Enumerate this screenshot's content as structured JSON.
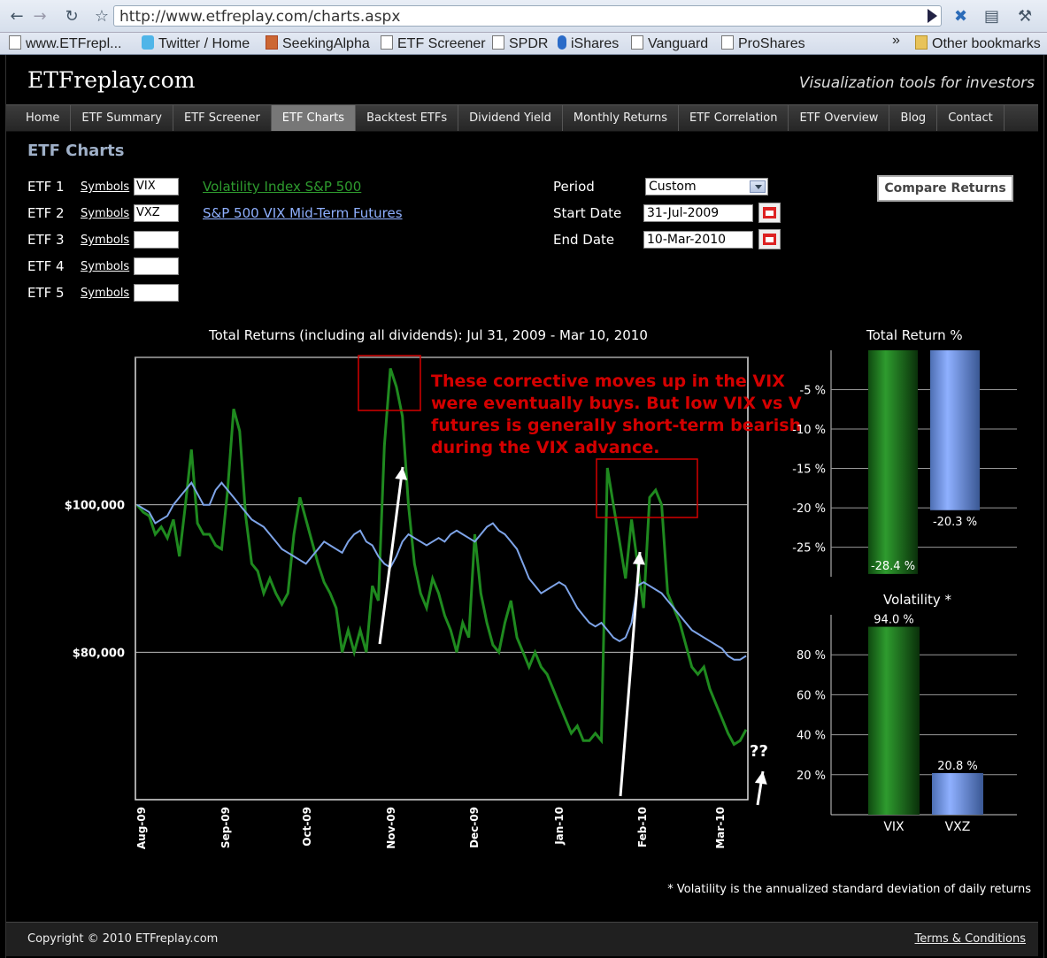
{
  "browser": {
    "url": "http://www.etfreplay.com/charts.aspx",
    "bookmarks": [
      "www.ETFrepl...",
      "Twitter / Home",
      "SeekingAlpha",
      "ETF Screener",
      "SPDR",
      "iShares",
      "Vanguard",
      "ProShares"
    ],
    "more": "»",
    "other_bookmarks": "Other bookmarks"
  },
  "site": {
    "logo": "ETFreplay.com",
    "tagline": "Visualization tools for investors"
  },
  "menu": [
    "Home",
    "ETF Summary",
    "ETF Screener",
    "ETF Charts",
    "Backtest ETFs",
    "Dividend Yield",
    "Monthly Returns",
    "ETF Correlation",
    "ETF Overview",
    "Blog",
    "Contact"
  ],
  "menu_active": "ETF Charts",
  "page_title": "ETF Charts",
  "etf_rows": [
    {
      "label": "ETF 1",
      "symbols": "Symbols",
      "value": "VIX",
      "name": "Volatility Index S&P 500",
      "color": "#2e9b2e"
    },
    {
      "label": "ETF 2",
      "symbols": "Symbols",
      "value": "VXZ",
      "name": "S&P 500 VIX Mid-Term Futures",
      "color": "#8fb0ff"
    },
    {
      "label": "ETF 3",
      "symbols": "Symbols",
      "value": "",
      "name": ""
    },
    {
      "label": "ETF 4",
      "symbols": "Symbols",
      "value": "",
      "name": ""
    },
    {
      "label": "ETF 5",
      "symbols": "Symbols",
      "value": "",
      "name": ""
    }
  ],
  "form": {
    "period_label": "Period",
    "period_value": "Custom",
    "start_label": "Start Date",
    "start_value": "31-Jul-2009",
    "end_label": "End Date",
    "end_value": "10-Mar-2010",
    "compare_button": "Compare Returns"
  },
  "annotation": {
    "lines": [
      "These corrective moves up in the VIX",
      "were eventually buys.  But low VIX vs VIX",
      "futures is generally short-term bearish",
      "during the VIX advance."
    ],
    "question": "??",
    "color": "#d40000"
  },
  "footnote": "* Volatility is the annualized standard deviation of daily returns",
  "footer": {
    "copyright": "Copyright © 2010 ETFreplay.com",
    "terms": "Terms & Conditions"
  },
  "chart_data": [
    {
      "type": "line",
      "title": "Total Returns (including all dividends): Jul 31, 2009 - Mar 10, 2010",
      "x_tick_labels": [
        "Aug-09",
        "Sep-09",
        "Oct-09",
        "Nov-09",
        "Dec-09",
        "Jan-10",
        "Feb-10",
        "Mar-10"
      ],
      "y_tick_labels": [
        "$100,000",
        "$80,000"
      ],
      "y_ticks": [
        100000,
        80000
      ],
      "ylim": [
        60000,
        120000
      ],
      "grid": true,
      "series": [
        {
          "name": "VIX",
          "color": "#1f8a1f",
          "values": [
            100000,
            99000,
            98500,
            96000,
            97000,
            95500,
            98000,
            93000,
            100000,
            107500,
            97500,
            96000,
            96000,
            94500,
            94000,
            102000,
            113000,
            110000,
            98500,
            92000,
            91000,
            88000,
            90000,
            88000,
            86500,
            88000,
            96000,
            101000,
            98000,
            95000,
            92000,
            89500,
            88000,
            86000,
            80000,
            83000,
            80000,
            83000,
            80000,
            89000,
            87000,
            108000,
            118500,
            116000,
            112000,
            100000,
            92000,
            88000,
            86000,
            90000,
            88000,
            85000,
            83000,
            80000,
            84000,
            82000,
            96000,
            88000,
            84000,
            81000,
            80000,
            84000,
            87000,
            82000,
            80000,
            78000,
            80000,
            78000,
            77000,
            75000,
            73000,
            71000,
            69000,
            70000,
            68000,
            68000,
            69000,
            68000,
            105000,
            100000,
            95000,
            90000,
            98000,
            92000,
            86000,
            101000,
            102000,
            100000,
            88000,
            86000,
            84000,
            81000,
            78000,
            77000,
            78000,
            75000,
            73000,
            71000,
            69000,
            67500,
            68000,
            69500
          ]
        },
        {
          "name": "VXZ",
          "color": "#7ea4e8",
          "values": [
            100000,
            99500,
            99000,
            97500,
            98000,
            98500,
            100000,
            101000,
            102000,
            103000,
            101500,
            100000,
            100000,
            102000,
            103000,
            102000,
            101000,
            100000,
            99000,
            98000,
            97500,
            97000,
            96000,
            95000,
            94000,
            93500,
            93000,
            92500,
            92000,
            93000,
            94000,
            95000,
            94500,
            94000,
            93500,
            95000,
            96000,
            96500,
            95000,
            94500,
            93000,
            92000,
            91500,
            93000,
            95000,
            96000,
            95500,
            95000,
            94500,
            95000,
            95500,
            95000,
            96000,
            96500,
            96000,
            95500,
            95000,
            96000,
            97000,
            97500,
            96500,
            96000,
            95000,
            94000,
            92000,
            90000,
            89000,
            88000,
            88500,
            89000,
            89500,
            89000,
            87500,
            86000,
            85000,
            84000,
            83500,
            84000,
            83000,
            82000,
            81500,
            82000,
            84000,
            89000,
            89500,
            89000,
            88500,
            88000,
            87000,
            86000,
            85000,
            84000,
            83000,
            82500,
            82000,
            81500,
            81000,
            80500,
            79500,
            79000,
            79000,
            79500
          ]
        }
      ],
      "annotation_boxes": [
        "Nov-09 spike",
        "Feb-10 spike"
      ]
    },
    {
      "type": "bar",
      "title": "Total Return %",
      "categories": [
        "VIX",
        "VXZ"
      ],
      "values": [
        -28.4,
        -20.3
      ],
      "value_labels": [
        "-28.4 %",
        "-20.3 %"
      ],
      "y_tick_labels": [
        "-5 %",
        "-10 %",
        "-15 %",
        "-20 %",
        "-25 %"
      ],
      "y_ticks": [
        -5,
        -10,
        -15,
        -20,
        -25
      ],
      "ylim": [
        -29.2,
        0
      ],
      "colors": [
        "#2e9b2e",
        "#8fb0ff"
      ],
      "grid": true
    },
    {
      "type": "bar",
      "title": "Volatility *",
      "categories": [
        "VIX",
        "VXZ"
      ],
      "values": [
        94.0,
        20.8
      ],
      "value_labels": [
        "94.0 %",
        "20.8 %"
      ],
      "y_tick_labels": [
        "80 %",
        "60 %",
        "40 %",
        "20 %"
      ],
      "y_ticks": [
        80,
        60,
        40,
        20
      ],
      "ylim": [
        0,
        100
      ],
      "colors": [
        "#2e9b2e",
        "#8fb0ff"
      ],
      "grid": true
    }
  ]
}
